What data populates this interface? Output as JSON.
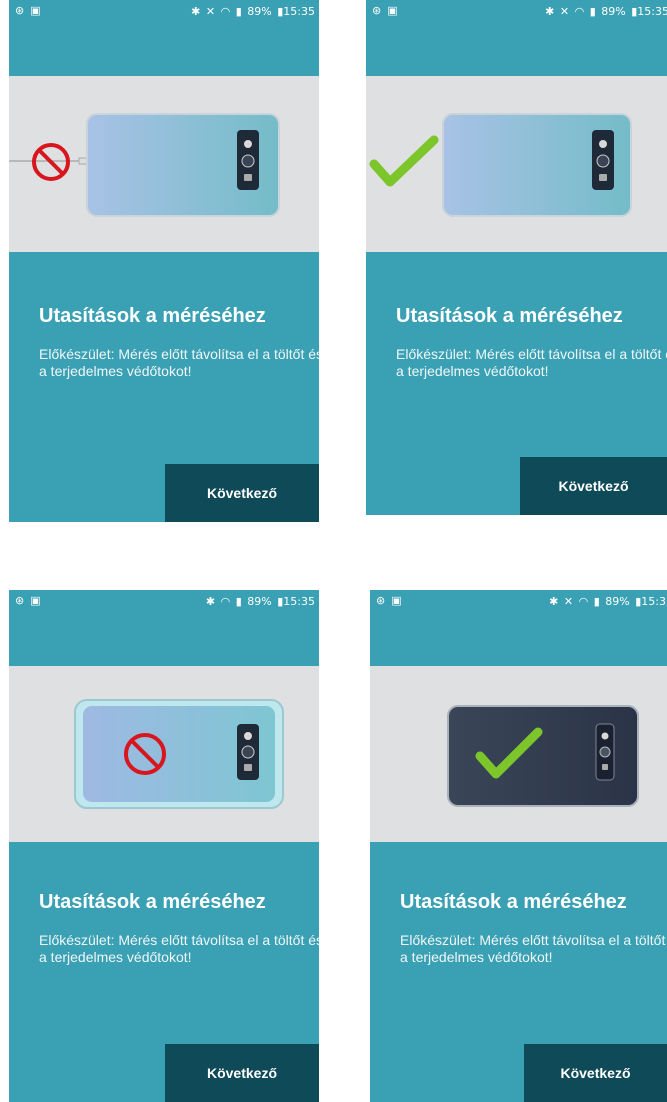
{
  "status_bar": {
    "battery": "89%",
    "time": "15:35",
    "icons": [
      "percent-badge-icon",
      "gallery-icon",
      "bluetooth-icon",
      "mute-icon",
      "wifi-icon",
      "data-icon",
      "signal-icon",
      "battery-icon"
    ]
  },
  "instructions": {
    "title": "Utasítások a méréséhez",
    "body": "Előkészület: Mérés előtt távolítsa el a töltőt és a terjedelmes védőtokot!"
  },
  "next_button": {
    "label": "Következő"
  },
  "colors": {
    "teal": "#3aa0b4",
    "button": "#0f4a58",
    "hero_bg": "#dfe0e1",
    "forbidden": "#d7161d",
    "ok": "#7cc52b"
  },
  "screens": [
    {
      "illustration": "phone-with-charger",
      "status_mark": "forbidden-icon"
    },
    {
      "illustration": "phone-without-charger",
      "status_mark": "check-icon"
    },
    {
      "illustration": "phone-in-case",
      "status_mark": "forbidden-icon"
    },
    {
      "illustration": "phone-without-case",
      "status_mark": "check-icon"
    }
  ]
}
